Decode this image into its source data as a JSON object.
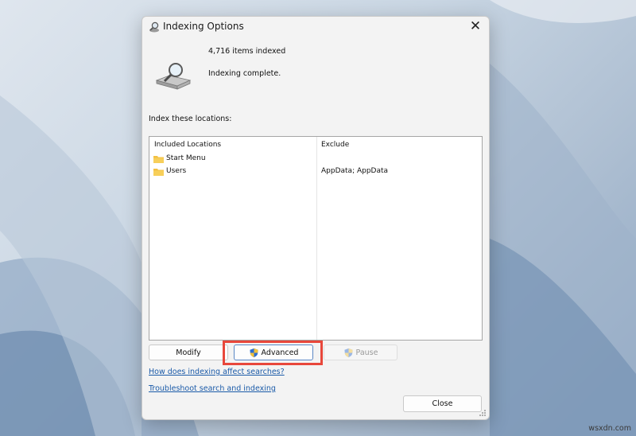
{
  "window": {
    "title": "Indexing Options",
    "close_glyph": "✕",
    "icon": "indexing-magnifier-icon"
  },
  "status": {
    "items_indexed": "4,716 items indexed",
    "state": "Indexing complete."
  },
  "locations": {
    "label": "Index these locations:",
    "headers": {
      "included": "Included Locations",
      "exclude": "Exclude"
    },
    "rows": [
      {
        "name": "Start Menu",
        "exclude": ""
      },
      {
        "name": "Users",
        "exclude": "AppData; AppData"
      }
    ]
  },
  "buttons": {
    "modify": "Modify",
    "advanced": "Advanced",
    "pause": "Pause",
    "close": "Close"
  },
  "links": {
    "how": "How does indexing affect searches?",
    "troubleshoot": "Troubleshoot search and indexing"
  },
  "watermark": "wsxdn.com",
  "colors": {
    "highlight": "#e8473b",
    "link": "#1a5aa8",
    "folder": "#f3c042"
  }
}
